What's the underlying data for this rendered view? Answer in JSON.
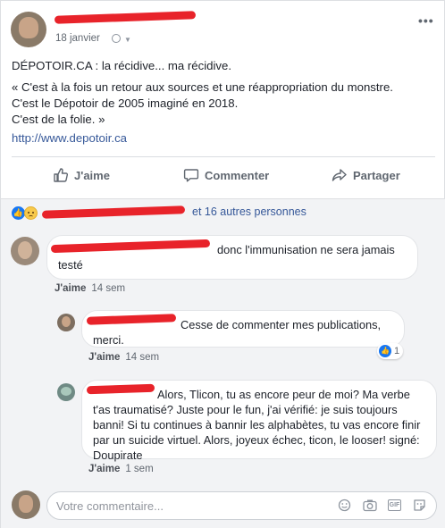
{
  "post": {
    "date": "18 janvier",
    "more_label": "•••",
    "line1": "DÉPOTOIR.CA : la récidive... ma récidive.",
    "line2": "« C'est à la fois un retour aux sources et une réappropriation du monstre.",
    "line3": "C'est le Dépotoir de 2005 imaginé en 2018.",
    "line4": "C'est de la folie. »",
    "link": "http://www.depotoir.ca"
  },
  "actions": {
    "like": "J'aime",
    "comment": "Commenter",
    "share": "Partager"
  },
  "reactions": {
    "text": "et 16 autres personnes"
  },
  "comments": [
    {
      "text": "donc l'immunisation ne sera jamais testé",
      "like": "J'aime",
      "time": "14 sem"
    },
    {
      "text": "Cesse de commenter mes publications, merci.",
      "like": "J'aime",
      "time": "14 sem",
      "like_count": "1"
    },
    {
      "text": "Alors, Tlicon, tu as encore peur de moi? Ma verbe t'as traumatisé? Juste pour le fun, j'ai vérifié: je suis toujours banni! Si tu continues à bannir les alphabètes, tu vas encore finir par un suicide virtuel. Alors, joyeux échec, ticon, le looser! signé: Doupirate",
      "like": "J'aime",
      "time": "1 sem"
    }
  ],
  "composer": {
    "placeholder": "Votre commentaire...",
    "gif_label": "GIF"
  },
  "colors": {
    "link": "#365899",
    "redaction": "#e8232a",
    "like_blue": "#1877f2"
  }
}
